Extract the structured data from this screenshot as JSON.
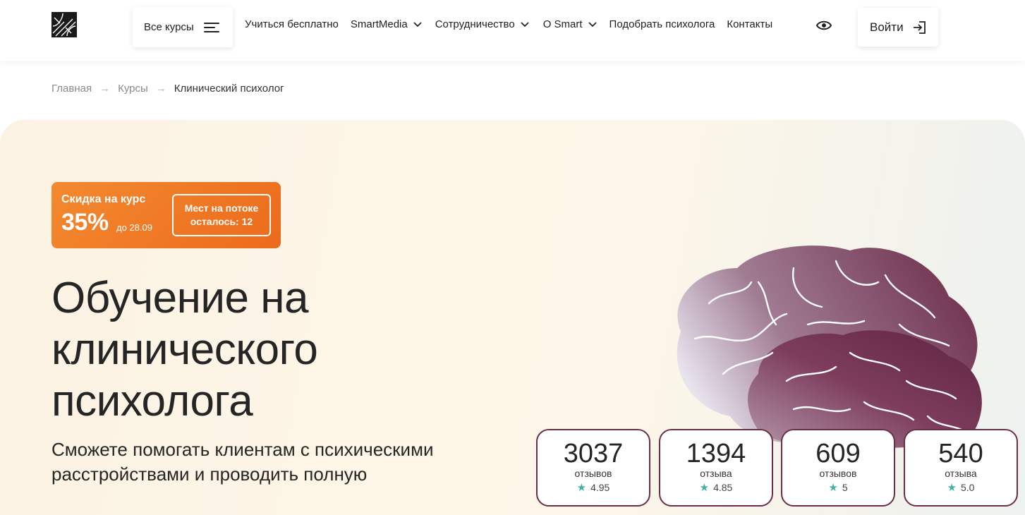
{
  "header": {
    "all_courses_label": "Все курсы",
    "nav": [
      {
        "label": "Учиться бесплатно",
        "has_dropdown": false
      },
      {
        "label": "SmartMedia",
        "has_dropdown": true
      },
      {
        "label": "Сотрудничество",
        "has_dropdown": true
      },
      {
        "label": "O Smart",
        "has_dropdown": true
      },
      {
        "label": "Подобрать психолога",
        "has_dropdown": false
      },
      {
        "label": "Контакты",
        "has_dropdown": false
      }
    ],
    "login_label": "Войти"
  },
  "breadcrumb": {
    "items": [
      "Главная",
      "Курсы",
      "Клинический психолог"
    ],
    "separator": "→"
  },
  "promo": {
    "title": "Скидка на курс",
    "percent": "35%",
    "until": "до 28.09",
    "seats_line1": "Мест на потоке",
    "seats_line2": "осталось: 12"
  },
  "hero": {
    "title_line1": "Обучение на",
    "title_line2": "клинического",
    "title_line3": "психолога",
    "subtitle_line1": "Сможете помогать клиентам с психическими",
    "subtitle_line2": "расстройствами и проводить полную"
  },
  "stats": [
    {
      "count": "3037",
      "label": "отзывов",
      "rating": "4.95"
    },
    {
      "count": "1394",
      "label": "отзыва",
      "rating": "4.85"
    },
    {
      "count": "609",
      "label": "отзывов",
      "rating": "5"
    },
    {
      "count": "540",
      "label": "отзыва",
      "rating": "5.0"
    }
  ],
  "colors": {
    "promo_orange": "#ee6f20",
    "card_border": "#6b2e48",
    "star": "#3db3a8",
    "brain": "#7a3a58"
  },
  "icons": [
    "logo-icon",
    "menu-icon",
    "chevron-down-icon",
    "eye-icon",
    "login-icon",
    "star-icon",
    "brain-illustration"
  ]
}
